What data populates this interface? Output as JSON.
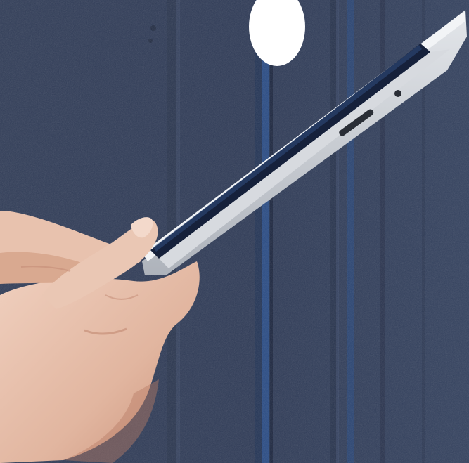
{
  "scene": {
    "subject": "hand-holding-tablet",
    "colors": {
      "wall": "#2f3c58",
      "wall_dark": "#222c44",
      "wall_light": "#3b4a68",
      "seam_blue": "#2a4f8c",
      "tablet_body": "#c9ccd2",
      "tablet_edge": "#eef0f3",
      "tablet_screen": "#15203a",
      "skin": "#e2b9a4",
      "skin_shadow": "#c58f78",
      "skin_light": "#f1d3c3",
      "cutout": "#ffffff"
    },
    "icons": {
      "tablet": "tablet-device",
      "hand": "hand",
      "overlay": "white-oval-marker"
    }
  }
}
